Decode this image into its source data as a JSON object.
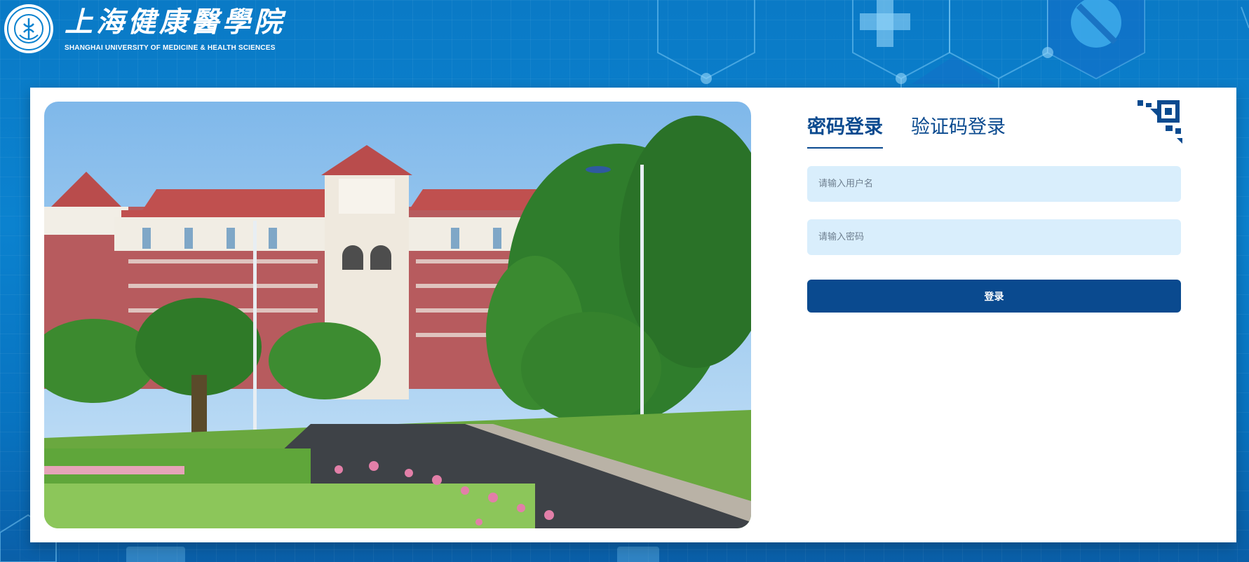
{
  "header": {
    "school_name_cn": "上海健康醫學院",
    "school_name_en": "SHANGHAI UNIVERSITY OF MEDICINE & HEALTH SCIENCES"
  },
  "login": {
    "tabs": [
      {
        "label": "密码登录",
        "active": true
      },
      {
        "label": "验证码登录",
        "active": false
      }
    ],
    "username_placeholder": "请输入用户名",
    "password_placeholder": "请输入密码",
    "submit_label": "登录",
    "qr_icon": "qr-code-corner-icon"
  },
  "colors": {
    "background": "#0b82cf",
    "brand_navy": "#0a4a8f",
    "input_fill": "#d9eefc"
  }
}
